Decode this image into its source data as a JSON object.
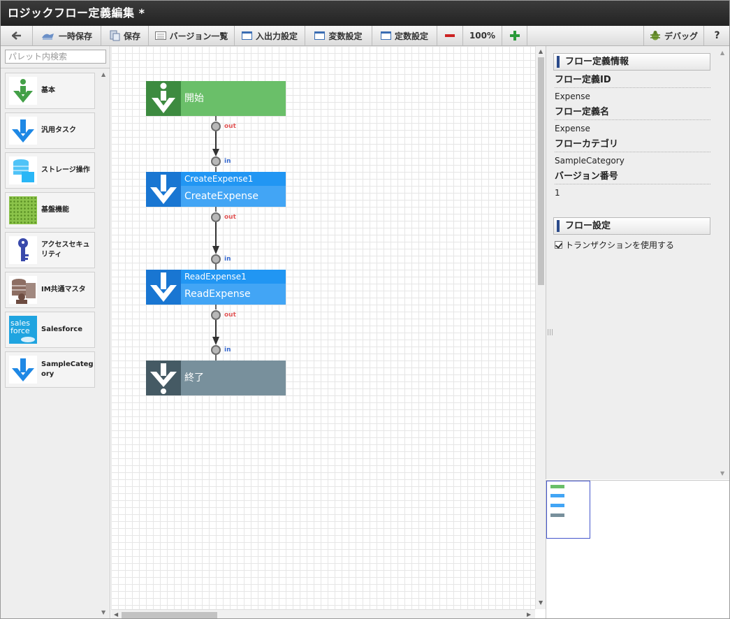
{
  "window": {
    "title": "ロジックフロー定義編集  *"
  },
  "toolbar": {
    "back_label": "",
    "temp_save_label": "一時保存",
    "save_label": "保存",
    "version_list_label": "バージョン一覧",
    "io_settings_label": "入出力設定",
    "variable_settings_label": "変数設定",
    "constant_settings_label": "定数設定",
    "zoom_level": "100%",
    "debug_label": "デバッグ",
    "help_label": "?"
  },
  "palette": {
    "search_placeholder": "パレット内検索",
    "items": [
      {
        "label": "基本",
        "icon": "info-arrow-icon"
      },
      {
        "label": "汎用タスク",
        "icon": "arrow-down-icon"
      },
      {
        "label": "ストレージ操作",
        "icon": "storage-icon"
      },
      {
        "label": "基盤機能",
        "icon": "grid-icon"
      },
      {
        "label": "アクセスセキュリティ",
        "label_line1": "アクセスセキュ",
        "label_line2": "リティ",
        "icon": "key-icon"
      },
      {
        "label": "IM共通マスタ",
        "icon": "master-icon"
      },
      {
        "label": "Salesforce",
        "icon": "salesforce-icon",
        "icon_text_1": "sales",
        "icon_text_2": "force"
      },
      {
        "label": "SampleCategory",
        "label_line1": "SampleCateg",
        "label_line2": "ory",
        "icon": "arrow-down-icon"
      }
    ]
  },
  "flow": {
    "nodes": [
      {
        "type": "start",
        "title": "開始",
        "color": "#6abf69",
        "icon_color": "#3d8b40"
      },
      {
        "type": "task",
        "head": "CreateExpense1",
        "sub": "CreateExpense",
        "color": "#42a5f5",
        "head_color": "#2196f3",
        "icon_color": "#1976d2"
      },
      {
        "type": "task",
        "head": "ReadExpense1",
        "sub": "ReadExpense",
        "color": "#42a5f5",
        "head_color": "#2196f3",
        "icon_color": "#1976d2"
      },
      {
        "type": "end",
        "title": "終了",
        "color": "#78909c",
        "icon_color": "#455a64"
      }
    ],
    "out_label": "out",
    "in_label": "in"
  },
  "properties": {
    "info_header": "フロー定義情報",
    "fields": [
      {
        "label": "フロー定義ID",
        "value": "Expense"
      },
      {
        "label": "フロー定義名",
        "value": "Expense"
      },
      {
        "label": "フローカテゴリ",
        "value": "SampleCategory"
      },
      {
        "label": "バージョン番号",
        "value": "1"
      }
    ],
    "settings_header": "フロー設定",
    "use_transaction_label": "トランザクションを使用する",
    "use_transaction_checked": true
  },
  "colors": {
    "accent": "#2b4a8a",
    "start_green": "#6abf69",
    "task_blue": "#42a5f5",
    "end_gray": "#78909c"
  }
}
